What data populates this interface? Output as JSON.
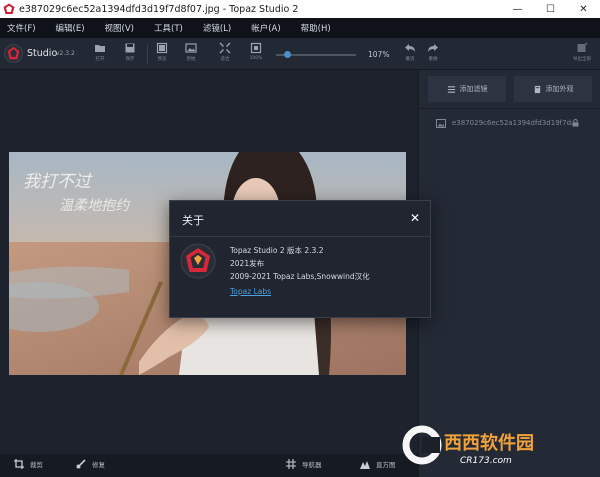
{
  "window": {
    "title": "e387029c6ec52a1394dfd3d19f7d8f07.jpg - Topaz Studio 2",
    "min_glyph": "—",
    "max_glyph": "☐",
    "close_glyph": "✕"
  },
  "menu": [
    "文件(F)",
    "编辑(E)",
    "视图(V)",
    "工具(T)",
    "滤镜(L)",
    "帐户(A)",
    "帮助(H)"
  ],
  "toolbar": {
    "studio_label": "Studio",
    "version": "v2.3.2",
    "tools": [
      {
        "icon": "folder-icon",
        "label": "打开"
      },
      {
        "icon": "save-icon",
        "label": "保存"
      },
      {
        "icon": "compare-icon",
        "label": "预览"
      },
      {
        "icon": "image-icon",
        "label": "原始"
      },
      {
        "icon": "fit-icon",
        "label": "适合"
      },
      {
        "icon": "actual-size-icon",
        "label": "100%"
      }
    ],
    "zoom_percent": "107%",
    "zoom_level": 1.07,
    "undo_label": "撤消",
    "redo_label": "重做",
    "export_label": "导出全部"
  },
  "right_panel": {
    "add_filter_label": "添加滤镜",
    "add_mask_label": "添加外观",
    "file_name": "e387029c6ec52a1394dfd3d19f7d8..."
  },
  "bottom_bar": {
    "crop_label": "裁剪",
    "retouch_label": "修复",
    "navigator_label": "导航器",
    "histogram_label": "直方图"
  },
  "about_dialog": {
    "title": "关于",
    "close_glyph": "✕",
    "product_line": "Topaz Studio 2 版本 2.3.2",
    "release_line": "2021发布",
    "copyright_line": "2009-2021 Topaz Labs,Snowwind汉化",
    "link_text": "Topaz Labs"
  },
  "photo": {
    "caption_calligraphy": "我打不过 温柔地抱约"
  },
  "watermark": {
    "brand": "西西软件园",
    "url": "CR173.com"
  },
  "colors": {
    "accent_red": "#d6283a",
    "link_blue": "#4aa3e0",
    "slider_blue": "#4a90c8",
    "panel_bg": "#232935"
  }
}
